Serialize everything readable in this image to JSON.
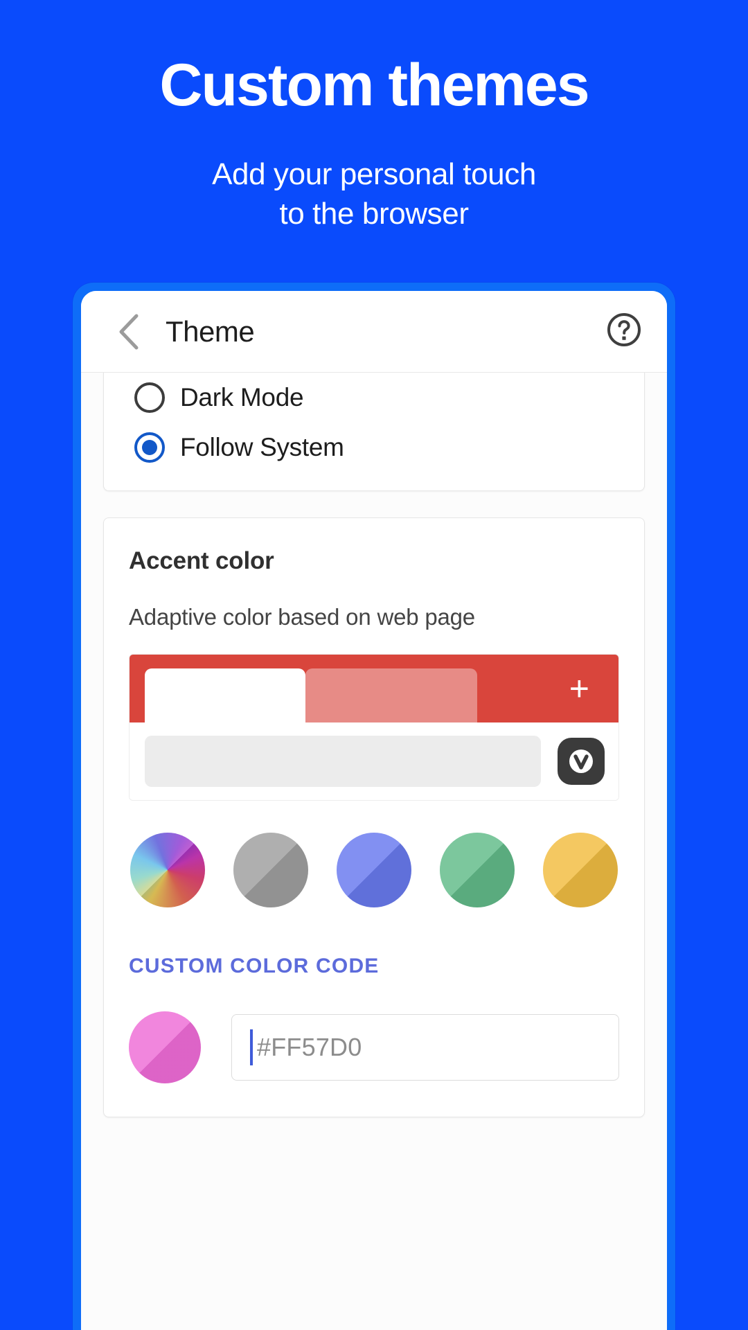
{
  "promo": {
    "title": "Custom themes",
    "subtitle_line1": "Add your personal touch",
    "subtitle_line2": "to the browser",
    "background_color": "#0A4BFC",
    "text_color": "#FFFFFF"
  },
  "device": {
    "frame_color": "#0E6DF8"
  },
  "appbar": {
    "title": "Theme",
    "back_icon": "chevron-left-icon",
    "help_icon": "help-circle-icon"
  },
  "theme_mode": {
    "options": [
      {
        "label": "Dark Mode",
        "selected": false
      },
      {
        "label": "Follow System",
        "selected": true
      }
    ],
    "selected_color": "#1258C8"
  },
  "accent": {
    "title": "Accent color",
    "description": "Adaptive color based on web page",
    "preview": {
      "toolbar_color": "#D9453C",
      "active_tab_color": "#FFFFFF",
      "inactive_tab_color": "#E78078",
      "new_tab_icon": "plus-icon",
      "url_field_color": "#ECECEC",
      "logo_icon": "vivaldi-logo-icon"
    },
    "swatches": [
      {
        "name": "adaptive-rainbow",
        "color": "rainbow",
        "selected": true
      },
      {
        "name": "gray",
        "color": "#A0A0A0",
        "selected": false
      },
      {
        "name": "blue",
        "color": "#6A7BF0",
        "selected": false
      },
      {
        "name": "green",
        "color": "#63BC8A",
        "selected": false
      },
      {
        "name": "yellow",
        "color": "#F2BE43",
        "selected": false
      }
    ],
    "custom": {
      "label": "CUSTOM COLOR CODE",
      "label_color": "#5C6BDB",
      "dot_color": "#EE6BD6",
      "input_value": "",
      "input_placeholder": "#FF57D0"
    }
  }
}
